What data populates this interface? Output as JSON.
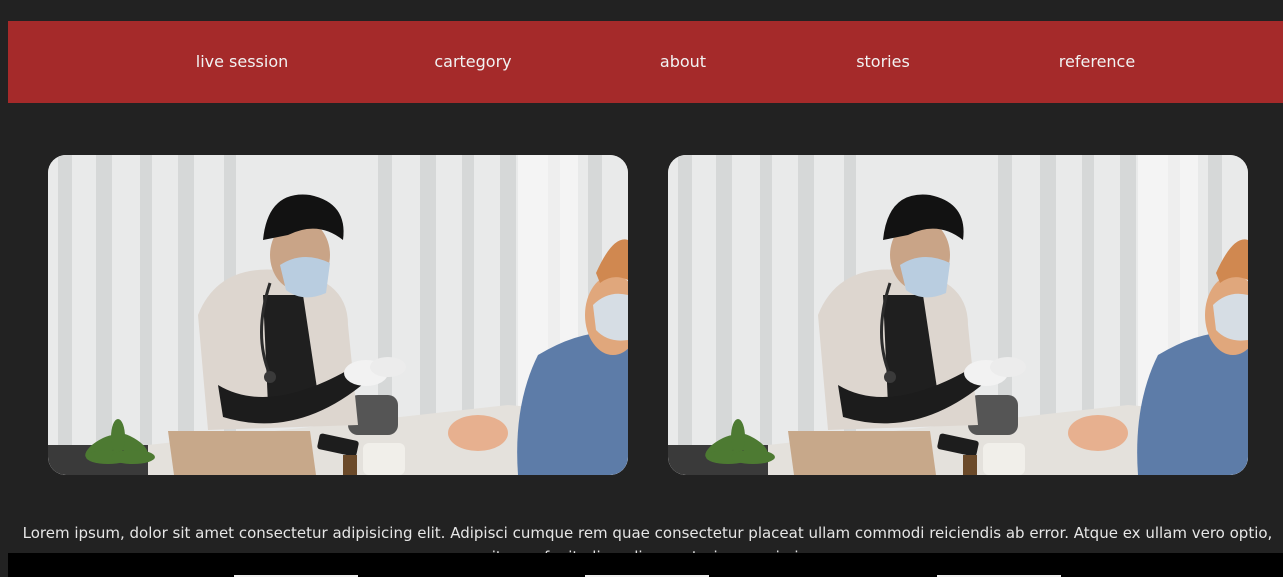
{
  "nav": {
    "items": [
      {
        "label": "live session"
      },
      {
        "label": "cartegory"
      },
      {
        "label": "about"
      },
      {
        "label": "stories"
      },
      {
        "label": "reference"
      }
    ]
  },
  "gallery": {
    "images": [
      {
        "icon": "doctor-consultation-photo"
      },
      {
        "icon": "doctor-consultation-photo"
      }
    ]
  },
  "caption": {
    "text": "Lorem ipsum, dolor sit amet consectetur adipisicing elit. Adipisci cumque rem quae consectetur placeat ullam commodi reiciendis ab error. Atque ex ullam vero optio, itaque fugit eligendi excepturi rem animi."
  },
  "colors": {
    "background": "#222222",
    "navbar": "#a52a2a",
    "nav_text": "#f2f2f2",
    "footer": "#000000"
  }
}
